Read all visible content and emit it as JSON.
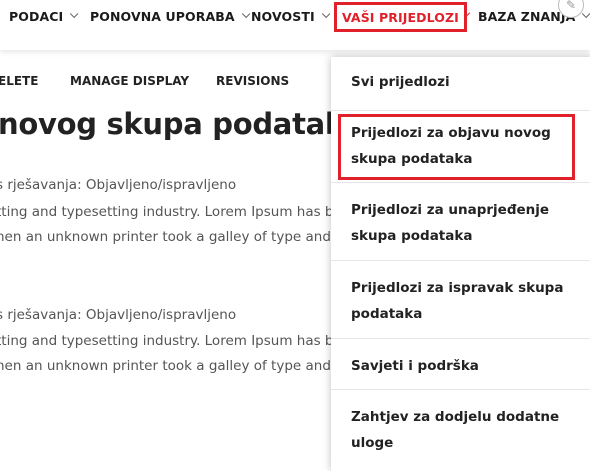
{
  "colors": {
    "accent": "#e0202a",
    "text": "#222222",
    "muted": "#555555"
  },
  "nav": {
    "items": [
      {
        "label": "PODACI"
      },
      {
        "label": "PONOVNA UPORABA"
      },
      {
        "label": "NOVOSTI"
      },
      {
        "label": "VAŠI PRIJEDLOZI"
      },
      {
        "label": "BAZA ZNANJA"
      }
    ],
    "edit_icon": "pencil-icon"
  },
  "tabs": [
    {
      "label": "ELETE"
    },
    {
      "label": "MANAGE DISPLAY"
    },
    {
      "label": "REVISIONS"
    }
  ],
  "main": {
    "title": "novog skupa podataka",
    "lines": [
      "s rješavanja: Objavljeno/ispravljeno",
      "tting and typesetting industry. Lorem Ipsum has bee",
      "hen an unknown printer took a galley of type and sc",
      "s rješavanja: Objavljeno/ispravljeno",
      "tting and typesetting industry. Lorem Ipsum has bee",
      "hen an unknown printer took a galley of type and sc"
    ]
  },
  "dropdown": {
    "items": [
      {
        "label": "Svi prijedlozi"
      },
      {
        "label": "Prijedlozi za objavu novog skupa podataka"
      },
      {
        "label": "Prijedlozi za unaprjeđenje skupa podataka"
      },
      {
        "label": "Prijedlozi za ispravak skupa podataka"
      },
      {
        "label": "Savjeti i podrška"
      },
      {
        "label": "Zahtjev za dodjelu dodatne uloge"
      }
    ]
  }
}
